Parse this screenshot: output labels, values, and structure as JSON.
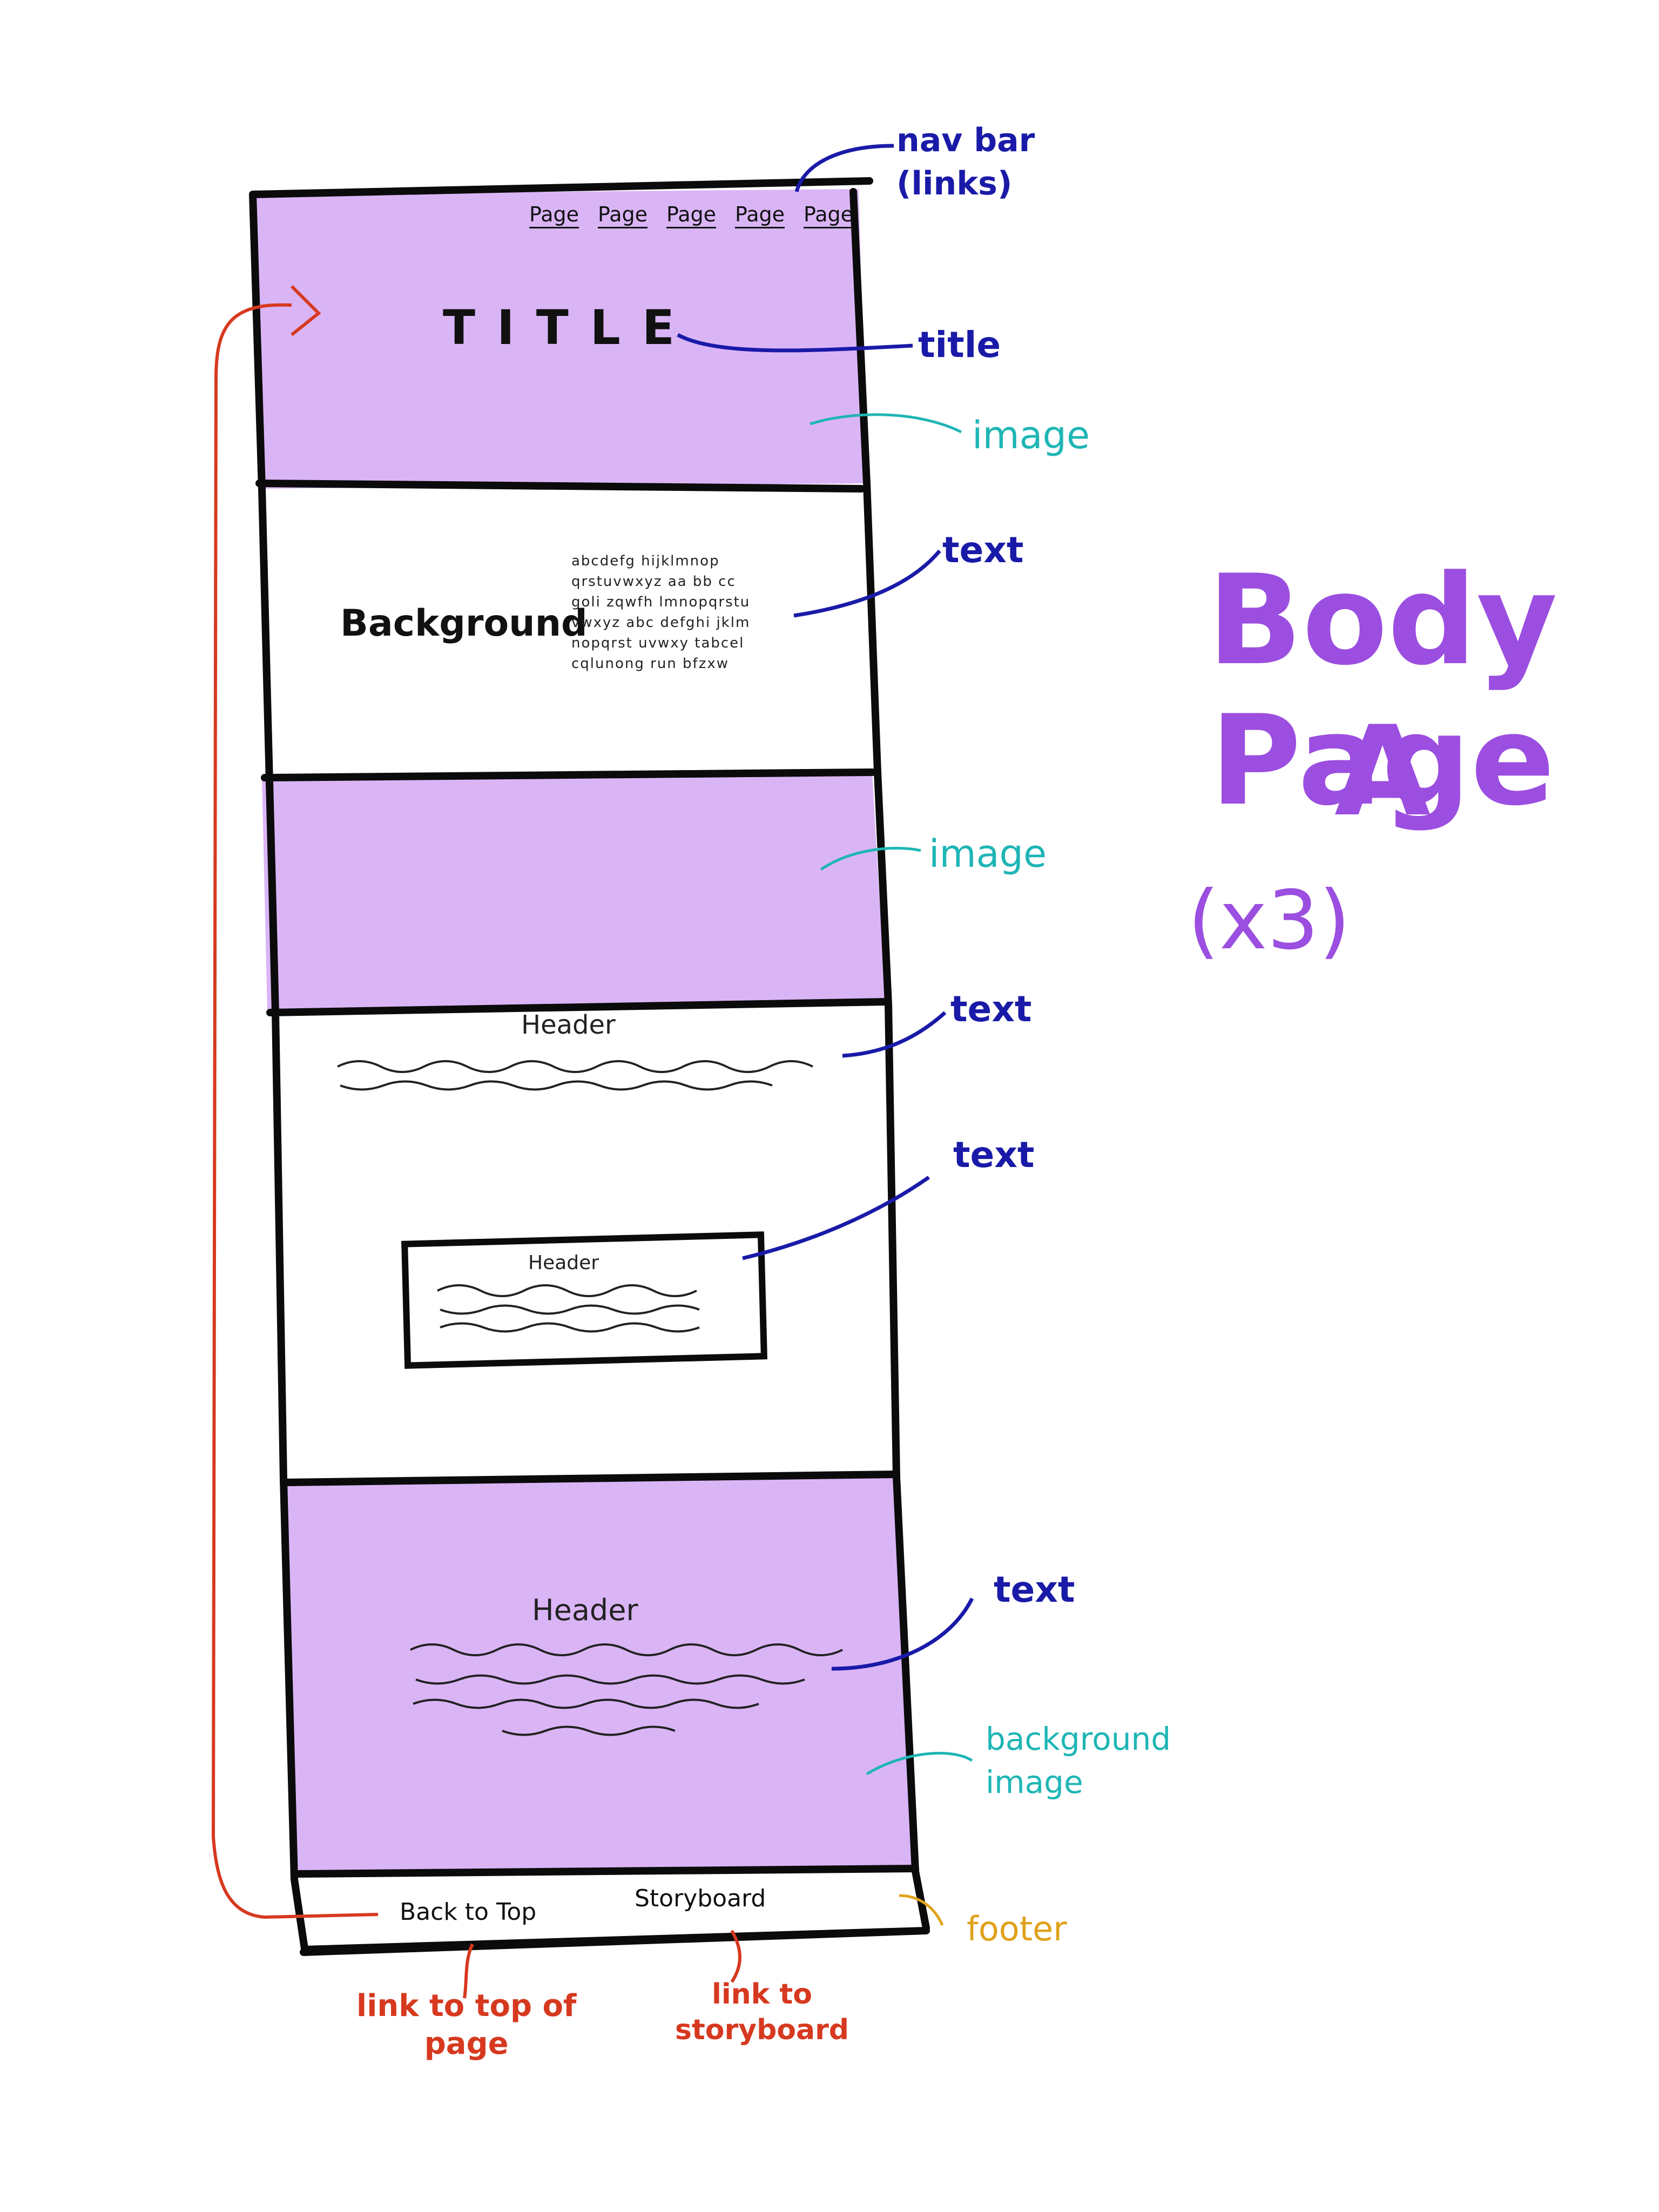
{
  "colors": {
    "section_fill": "#dab5f6",
    "outline": "#0b0b0b",
    "annotation_blue": "#1a1aa8",
    "annotation_teal": "#1fb5b5",
    "annotation_red": "#d6391f",
    "annotation_orange": "#e0a11a",
    "page_title": "#9b4ee0"
  },
  "wireframe": {
    "nav_links": [
      "Page",
      "Page",
      "Page",
      "Page",
      "Page"
    ],
    "title": "TITLE",
    "background_heading": "Background",
    "background_text": "abcdefg hijklmnop\nqrstuvwxyz aa bb cc\ngoli zqwfh lmnopqrstu\nvwxyz abc defghi jklm\nnopqrst uvwxy tabcel\ncqlunong run bfzxw",
    "header_1": "Header",
    "header_2": "Header",
    "header_3": "Header",
    "footer_back_to_top": "Back to Top",
    "footer_storyboard": "Storyboard"
  },
  "annotations": {
    "nav_bar": "nav bar\n(links)",
    "title": "title",
    "image_1": "image",
    "text_1": "text",
    "image_2": "image",
    "text_2": "text",
    "text_3": "text",
    "text_4": "text",
    "background_image": "background\nimage",
    "footer": "footer",
    "link_to_top": "link to top of\npage",
    "link_to_storyboard": "link to\nstoryboard"
  },
  "page_label": {
    "line1": "Body Page",
    "line2": "A",
    "line3": "(x3)"
  }
}
